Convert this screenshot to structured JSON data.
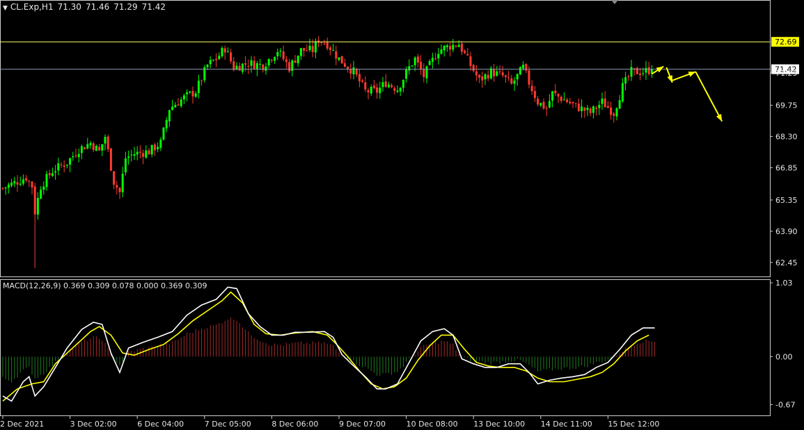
{
  "header": {
    "symbol": "CL.Exp,H1",
    "open": "71.30",
    "high": "71.46",
    "low": "71.29",
    "close": "71.42"
  },
  "macd_header": {
    "name": "MACD(12,26,9)",
    "values": "0.369 0.309 0.078 0.000 0.369 0.309"
  },
  "colors": {
    "background": "#000000",
    "bull": "#00ff00",
    "bear": "#ff3b30",
    "macd_line": "#ffffff",
    "signal_line": "#ffff00",
    "hist_pos": "#a52a2a",
    "hist_neg": "#1f7a1f",
    "level_line": "#ffff66",
    "bid_line": "#8a9ab0",
    "arrow": "#ffff00"
  },
  "chart_data": [
    {
      "type": "candlestick",
      "title": "",
      "ylim": [
        61.8,
        74.6
      ],
      "y_ticks": [
        "72.69",
        "71.25",
        "69.75",
        "68.30",
        "66.85",
        "65.35",
        "63.90",
        "62.45"
      ],
      "y_tick_values": [
        72.69,
        71.25,
        69.75,
        68.3,
        66.85,
        65.35,
        63.9,
        62.45
      ],
      "price_labels": [
        {
          "label": "72.69",
          "value": 72.69
        },
        {
          "label": "71.42",
          "value": 71.42
        }
      ],
      "x_ticks": [
        "2 Dec 2021",
        "3 Dec 02:00",
        "6 Dec 04:00",
        "7 Dec 05:00",
        "8 Dec 06:00",
        "9 Dec 07:00",
        "10 Dec 08:00",
        "13 Dec 10:00",
        "14 Dec 11:00",
        "15 Dec 12:00"
      ],
      "close_path": [
        {
          "i": 0,
          "v": 65.9
        },
        {
          "i": 8,
          "v": 66.4
        },
        {
          "i": 10,
          "v": 66.0
        },
        {
          "i": 11,
          "v": 64.8
        },
        {
          "i": 13,
          "v": 66.0
        },
        {
          "i": 17,
          "v": 66.7
        },
        {
          "i": 22,
          "v": 67.1
        },
        {
          "i": 26,
          "v": 67.7
        },
        {
          "i": 30,
          "v": 68.0
        },
        {
          "i": 33,
          "v": 67.6
        },
        {
          "i": 35,
          "v": 68.3
        },
        {
          "i": 38,
          "v": 66.2
        },
        {
          "i": 40,
          "v": 65.7
        },
        {
          "i": 42,
          "v": 67.3
        },
        {
          "i": 45,
          "v": 67.5
        },
        {
          "i": 50,
          "v": 67.6
        },
        {
          "i": 54,
          "v": 68.0
        },
        {
          "i": 57,
          "v": 69.6
        },
        {
          "i": 62,
          "v": 70.1
        },
        {
          "i": 66,
          "v": 70.4
        },
        {
          "i": 70,
          "v": 71.6
        },
        {
          "i": 73,
          "v": 71.9
        },
        {
          "i": 76,
          "v": 72.4
        },
        {
          "i": 79,
          "v": 71.5
        },
        {
          "i": 84,
          "v": 71.7
        },
        {
          "i": 89,
          "v": 71.6
        },
        {
          "i": 94,
          "v": 72.3
        },
        {
          "i": 98,
          "v": 71.5
        },
        {
          "i": 102,
          "v": 72.3
        },
        {
          "i": 106,
          "v": 72.3
        },
        {
          "i": 108,
          "v": 72.8
        },
        {
          "i": 111,
          "v": 72.6
        },
        {
          "i": 115,
          "v": 71.9
        },
        {
          "i": 120,
          "v": 71.3
        },
        {
          "i": 124,
          "v": 70.4
        },
        {
          "i": 128,
          "v": 70.4
        },
        {
          "i": 131,
          "v": 70.8
        },
        {
          "i": 135,
          "v": 70.5
        },
        {
          "i": 139,
          "v": 71.5
        },
        {
          "i": 141,
          "v": 71.9
        },
        {
          "i": 144,
          "v": 71.1
        },
        {
          "i": 149,
          "v": 72.3
        },
        {
          "i": 153,
          "v": 72.5
        },
        {
          "i": 156,
          "v": 72.6
        },
        {
          "i": 160,
          "v": 71.6
        },
        {
          "i": 163,
          "v": 70.9
        },
        {
          "i": 167,
          "v": 71.3
        },
        {
          "i": 171,
          "v": 71.1
        },
        {
          "i": 174,
          "v": 70.7
        },
        {
          "i": 178,
          "v": 71.5
        },
        {
          "i": 180,
          "v": 70.8
        },
        {
          "i": 183,
          "v": 69.9
        },
        {
          "i": 186,
          "v": 69.6
        },
        {
          "i": 188,
          "v": 70.3
        },
        {
          "i": 192,
          "v": 70.0
        },
        {
          "i": 196,
          "v": 69.7
        },
        {
          "i": 201,
          "v": 69.4
        },
        {
          "i": 205,
          "v": 69.9
        },
        {
          "i": 209,
          "v": 69.4
        },
        {
          "i": 212,
          "v": 70.6
        },
        {
          "i": 215,
          "v": 71.3
        },
        {
          "i": 219,
          "v": 71.3
        },
        {
          "i": 222,
          "v": 71.42
        }
      ],
      "forecast_arrows": [
        {
          "from": {
            "i": 222,
            "v": 71.2
          },
          "to": {
            "i": 226,
            "v": 71.55
          }
        },
        {
          "from": {
            "i": 227,
            "v": 71.5
          },
          "to": {
            "i": 229,
            "v": 70.8
          }
        },
        {
          "from": {
            "i": 229,
            "v": 70.9
          },
          "to": {
            "i": 237,
            "v": 71.3
          }
        },
        {
          "from": {
            "i": 237,
            "v": 71.3
          },
          "to": {
            "i": 246,
            "v": 69.0
          }
        }
      ]
    },
    {
      "type": "macd",
      "ylim": [
        -0.82,
        1.07
      ],
      "y_ticks": [
        "1.03",
        "0.00",
        "-0.67"
      ],
      "y_tick_values": [
        1.03,
        0.0,
        -0.67
      ],
      "macd_path": [
        {
          "i": 0,
          "v": -0.55
        },
        {
          "i": 3,
          "v": -0.62
        },
        {
          "i": 7,
          "v": -0.35
        },
        {
          "i": 9,
          "v": -0.28
        },
        {
          "i": 11,
          "v": -0.55
        },
        {
          "i": 14,
          "v": -0.42
        },
        {
          "i": 18,
          "v": -0.15
        },
        {
          "i": 22,
          "v": 0.12
        },
        {
          "i": 27,
          "v": 0.38
        },
        {
          "i": 31,
          "v": 0.48
        },
        {
          "i": 34,
          "v": 0.45
        },
        {
          "i": 37,
          "v": 0.05
        },
        {
          "i": 40,
          "v": -0.22
        },
        {
          "i": 43,
          "v": 0.12
        },
        {
          "i": 48,
          "v": 0.2
        },
        {
          "i": 53,
          "v": 0.27
        },
        {
          "i": 58,
          "v": 0.35
        },
        {
          "i": 63,
          "v": 0.58
        },
        {
          "i": 68,
          "v": 0.72
        },
        {
          "i": 73,
          "v": 0.8
        },
        {
          "i": 77,
          "v": 0.97
        },
        {
          "i": 80,
          "v": 0.95
        },
        {
          "i": 84,
          "v": 0.6
        },
        {
          "i": 88,
          "v": 0.42
        },
        {
          "i": 92,
          "v": 0.3
        },
        {
          "i": 96,
          "v": 0.3
        },
        {
          "i": 100,
          "v": 0.34
        },
        {
          "i": 104,
          "v": 0.34
        },
        {
          "i": 110,
          "v": 0.35
        },
        {
          "i": 113,
          "v": 0.27
        },
        {
          "i": 116,
          "v": 0.03
        },
        {
          "i": 120,
          "v": -0.13
        },
        {
          "i": 124,
          "v": -0.28
        },
        {
          "i": 128,
          "v": -0.45
        },
        {
          "i": 131,
          "v": -0.45
        },
        {
          "i": 135,
          "v": -0.38
        },
        {
          "i": 139,
          "v": -0.08
        },
        {
          "i": 143,
          "v": 0.22
        },
        {
          "i": 147,
          "v": 0.35
        },
        {
          "i": 151,
          "v": 0.39
        },
        {
          "i": 154,
          "v": 0.3
        },
        {
          "i": 157,
          "v": -0.03
        },
        {
          "i": 161,
          "v": -0.1
        },
        {
          "i": 165,
          "v": -0.15
        },
        {
          "i": 169,
          "v": -0.15
        },
        {
          "i": 173,
          "v": -0.1
        },
        {
          "i": 177,
          "v": -0.1
        },
        {
          "i": 180,
          "v": -0.22
        },
        {
          "i": 183,
          "v": -0.38
        },
        {
          "i": 187,
          "v": -0.33
        },
        {
          "i": 191,
          "v": -0.3
        },
        {
          "i": 195,
          "v": -0.28
        },
        {
          "i": 199,
          "v": -0.25
        },
        {
          "i": 203,
          "v": -0.15
        },
        {
          "i": 207,
          "v": -0.08
        },
        {
          "i": 211,
          "v": 0.1
        },
        {
          "i": 215,
          "v": 0.3
        },
        {
          "i": 219,
          "v": 0.4
        },
        {
          "i": 223,
          "v": 0.4
        }
      ],
      "signal_path": [
        {
          "i": 0,
          "v": -0.62
        },
        {
          "i": 5,
          "v": -0.45
        },
        {
          "i": 10,
          "v": -0.38
        },
        {
          "i": 14,
          "v": -0.35
        },
        {
          "i": 18,
          "v": -0.1
        },
        {
          "i": 22,
          "v": 0.05
        },
        {
          "i": 26,
          "v": 0.2
        },
        {
          "i": 30,
          "v": 0.35
        },
        {
          "i": 33,
          "v": 0.42
        },
        {
          "i": 37,
          "v": 0.3
        },
        {
          "i": 41,
          "v": 0.05
        },
        {
          "i": 45,
          "v": 0.02
        },
        {
          "i": 50,
          "v": 0.1
        },
        {
          "i": 55,
          "v": 0.17
        },
        {
          "i": 60,
          "v": 0.32
        },
        {
          "i": 65,
          "v": 0.5
        },
        {
          "i": 70,
          "v": 0.64
        },
        {
          "i": 75,
          "v": 0.78
        },
        {
          "i": 78,
          "v": 0.9
        },
        {
          "i": 82,
          "v": 0.75
        },
        {
          "i": 86,
          "v": 0.45
        },
        {
          "i": 90,
          "v": 0.32
        },
        {
          "i": 95,
          "v": 0.3
        },
        {
          "i": 100,
          "v": 0.33
        },
        {
          "i": 106,
          "v": 0.35
        },
        {
          "i": 111,
          "v": 0.3
        },
        {
          "i": 114,
          "v": 0.18
        },
        {
          "i": 118,
          "v": 0.0
        },
        {
          "i": 122,
          "v": -0.2
        },
        {
          "i": 126,
          "v": -0.38
        },
        {
          "i": 130,
          "v": -0.45
        },
        {
          "i": 134,
          "v": -0.42
        },
        {
          "i": 138,
          "v": -0.3
        },
        {
          "i": 142,
          "v": -0.05
        },
        {
          "i": 146,
          "v": 0.15
        },
        {
          "i": 150,
          "v": 0.3
        },
        {
          "i": 154,
          "v": 0.3
        },
        {
          "i": 158,
          "v": 0.1
        },
        {
          "i": 162,
          "v": -0.08
        },
        {
          "i": 166,
          "v": -0.13
        },
        {
          "i": 170,
          "v": -0.15
        },
        {
          "i": 175,
          "v": -0.15
        },
        {
          "i": 179,
          "v": -0.2
        },
        {
          "i": 183,
          "v": -0.3
        },
        {
          "i": 187,
          "v": -0.35
        },
        {
          "i": 192,
          "v": -0.35
        },
        {
          "i": 196,
          "v": -0.32
        },
        {
          "i": 201,
          "v": -0.28
        },
        {
          "i": 205,
          "v": -0.22
        },
        {
          "i": 209,
          "v": -0.1
        },
        {
          "i": 213,
          "v": 0.08
        },
        {
          "i": 217,
          "v": 0.22
        },
        {
          "i": 221,
          "v": 0.3
        }
      ]
    }
  ]
}
